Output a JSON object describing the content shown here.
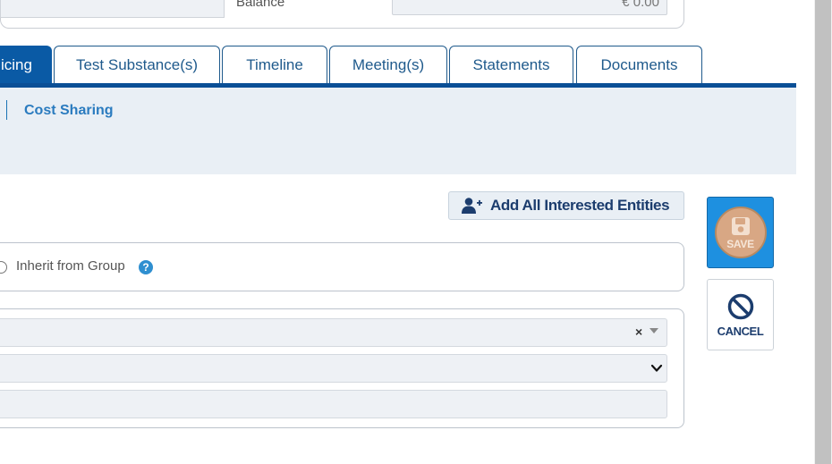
{
  "top": {
    "balance_label": "Balance",
    "balance_value": "€ 0.00"
  },
  "tabs": [
    {
      "label": "icing",
      "active": true
    },
    {
      "label": "Test Substance(s)"
    },
    {
      "label": "Timeline"
    },
    {
      "label": "Meeting(s)"
    },
    {
      "label": "Statements"
    },
    {
      "label": "Documents"
    }
  ],
  "subnav": {
    "cost_sharing": "Cost Sharing"
  },
  "actions": {
    "add_all_label": "Add All Interested Entities",
    "save_label": "SAVE",
    "cancel_label": "CANCEL"
  },
  "form": {
    "inherit_label": "Inherit from Group",
    "help_glyph": "?",
    "clear_glyph": "×"
  },
  "colors": {
    "primary": "#0a5aa5",
    "tab_text": "#1f5a8c",
    "save_bg": "#1e90e0",
    "save_disc": "#d8a784",
    "subpanel_bg": "#e9eff5"
  },
  "icons": {
    "add_all": "add-user-icon",
    "save": "floppy-disk-icon",
    "cancel": "prohibited-icon",
    "help": "question-icon"
  }
}
